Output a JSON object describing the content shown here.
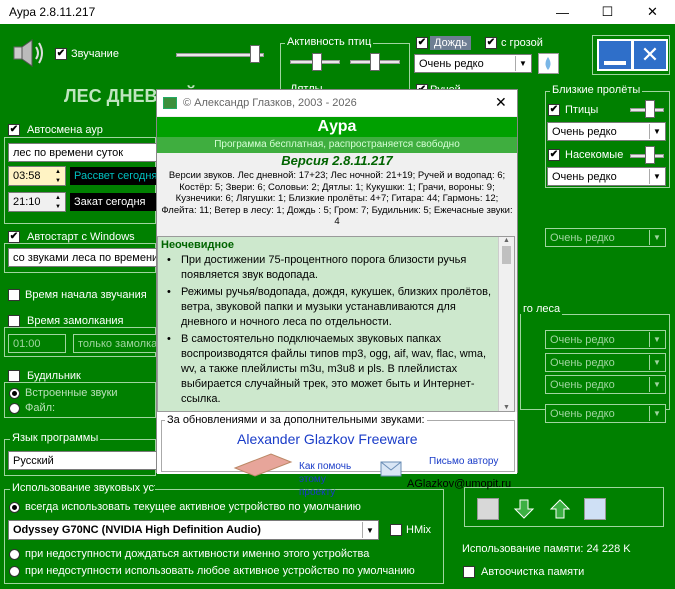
{
  "window": {
    "title": "Аура 2.8.11.217"
  },
  "sound": {
    "label": "Звучание",
    "checked": true
  },
  "scene_title": "ЛЕС ДНЕВНОЙ",
  "activity_birds": {
    "label": "Активность птиц"
  },
  "rain": {
    "label": "Дождь",
    "checked": true,
    "thunder_label": "с грозой",
    "thunder_checked": true,
    "freq": "Очень редко"
  },
  "hidden_labels": {
    "dyatly": "Дятлы",
    "ruchei": "Ручей"
  },
  "auto_change": {
    "label": "Автосмена аур",
    "checked": true,
    "mode": "лес по времени суток",
    "time1": "03:58",
    "event1": "Рассвет сегодня",
    "time2": "21:10",
    "event2": "Закат сегодня"
  },
  "autostart": {
    "label": "Автостарт с Windows",
    "checked": true,
    "mode": "со звуками леса по времени"
  },
  "start_time": {
    "label": "Время начала звучания",
    "checked": false
  },
  "silence_time": {
    "label": "Время замолкания",
    "checked": false,
    "time": "01:00",
    "mode": "только замолкание"
  },
  "alarm": {
    "label": "Будильник",
    "checked": false,
    "opt1": "Встроенные звуки",
    "opt2": "Файл:"
  },
  "language": {
    "label": "Язык программы",
    "value": "Русский"
  },
  "device": {
    "label": "Использование звуковых устройств",
    "opt_default": "всегда использовать текущее активное устройство по умолчанию",
    "device_name": "Odyssey G70NC (NVIDIA High Definition Audio)",
    "hmix_label": "HMix",
    "opt_wait": "при недоступности дождаться активности именно этого устройства",
    "opt_any": "при недоступности использовать любое активное устройство по умолчанию"
  },
  "near_flights": {
    "label": "Близкие пролёты",
    "birds": "Птицы",
    "birds_freq": "Очень редко",
    "insects": "Насекомые",
    "insects_freq": "Очень редко"
  },
  "right_freqs": [
    "Очень редко",
    "Очень редко",
    "Очень редко",
    "Очень редко",
    "Очень редко"
  ],
  "forest_label": "го леса",
  "memory": {
    "label": "Использование памяти: 24 228 K",
    "autoclean": "Автоочистка памяти"
  },
  "about": {
    "title": "© Александр Глазков,  2003 - 2026",
    "app": "Аура",
    "free": "Программа бесплатная, распространяется свободно",
    "version": "Версия 2.8.11.217",
    "sounds": "Версии звуков. Лес дневной: 17+23; Лес ночной: 21+19; Ручей и водопад: 6; Костёр: 5; Звери: 6; Соловьи: 2; Дятлы: 1; Кукушки: 1; Грачи, вороны: 9; Кузнечики: 6; Лягушки: 1; Близкие пролёты: 4+7; Гитара: 44; Гармонь: 12; Флейта: 11; Ветер в лесу: 1; Дождь : 5; Гром: 7; Будильник: 5; Ежечасные звуки: 4",
    "note_title": "Неочевидное",
    "notes": [
      "При достижении 75-процентного порога близости ручья появляется звук водопада.",
      "Режимы ручья/водопада, дождя, кукушек, близких пролётов, ветра, звуковой папки и музыки устанавливаются для дневного и ночного леса по отдельности.",
      "В самостоятельно подключаемых звуковых папках воспроизводятся файлы типов mp3, ogg, aif, wav, flac, wma, wv, а также плейлисты m3u, m3u8 и pls. В плейлистах выбирается случайный трек, это может быть и Интернет-ссылка."
    ],
    "updates_label": "За обновлениями и за дополнительными звуками:",
    "author_link": "Alexander Glazkov Freeware",
    "help_text": "Как помочь этому проекту",
    "mail_text": "Письмо автору",
    "email": "AGlazkov@umopit.ru"
  }
}
